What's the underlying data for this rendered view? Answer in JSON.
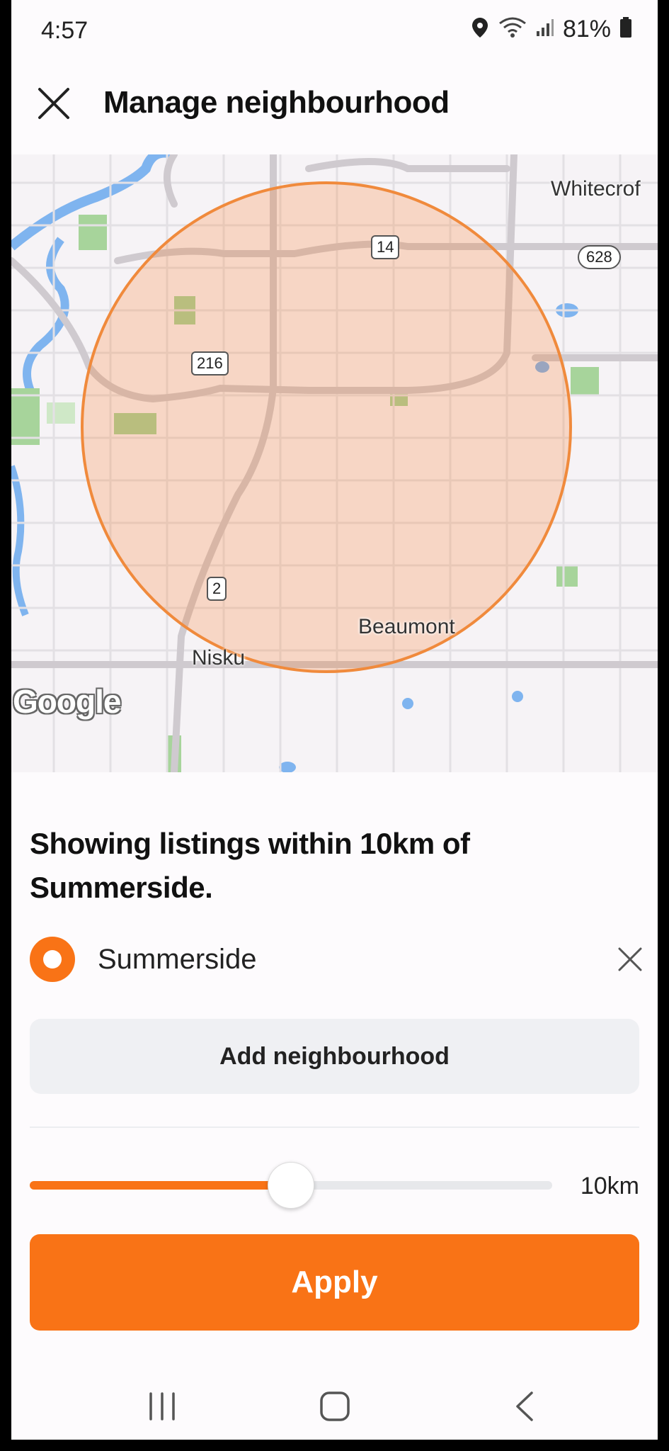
{
  "status_bar": {
    "time": "4:57",
    "battery": "81%",
    "icons": [
      "location-icon",
      "wifi-icon",
      "signal-icon",
      "battery-icon"
    ]
  },
  "header": {
    "title": "Manage neighbourhood",
    "close_icon": "close-icon"
  },
  "map": {
    "labels": {
      "whitecourt": "Whitecrof",
      "beaumont": "Beaumont",
      "nisku": "Nisku"
    },
    "shields": {
      "hwy14": "14",
      "hwy628": "628",
      "hwy216": "216",
      "hwy2": "2"
    },
    "attribution": "Google",
    "radius_color": "#f97316"
  },
  "sheet": {
    "summary": "Showing listings within 10km of Summerside.",
    "neighbourhood": {
      "name": "Summerside",
      "selected": true
    },
    "add_button": "Add neighbourhood",
    "slider": {
      "fraction": 0.5,
      "value_label": "10km"
    },
    "apply_button": "Apply"
  },
  "colors": {
    "accent": "#f97316",
    "button_bg": "#eff0f3"
  },
  "navbar": {
    "icons": [
      "recent-apps-icon",
      "home-icon",
      "back-icon"
    ]
  }
}
